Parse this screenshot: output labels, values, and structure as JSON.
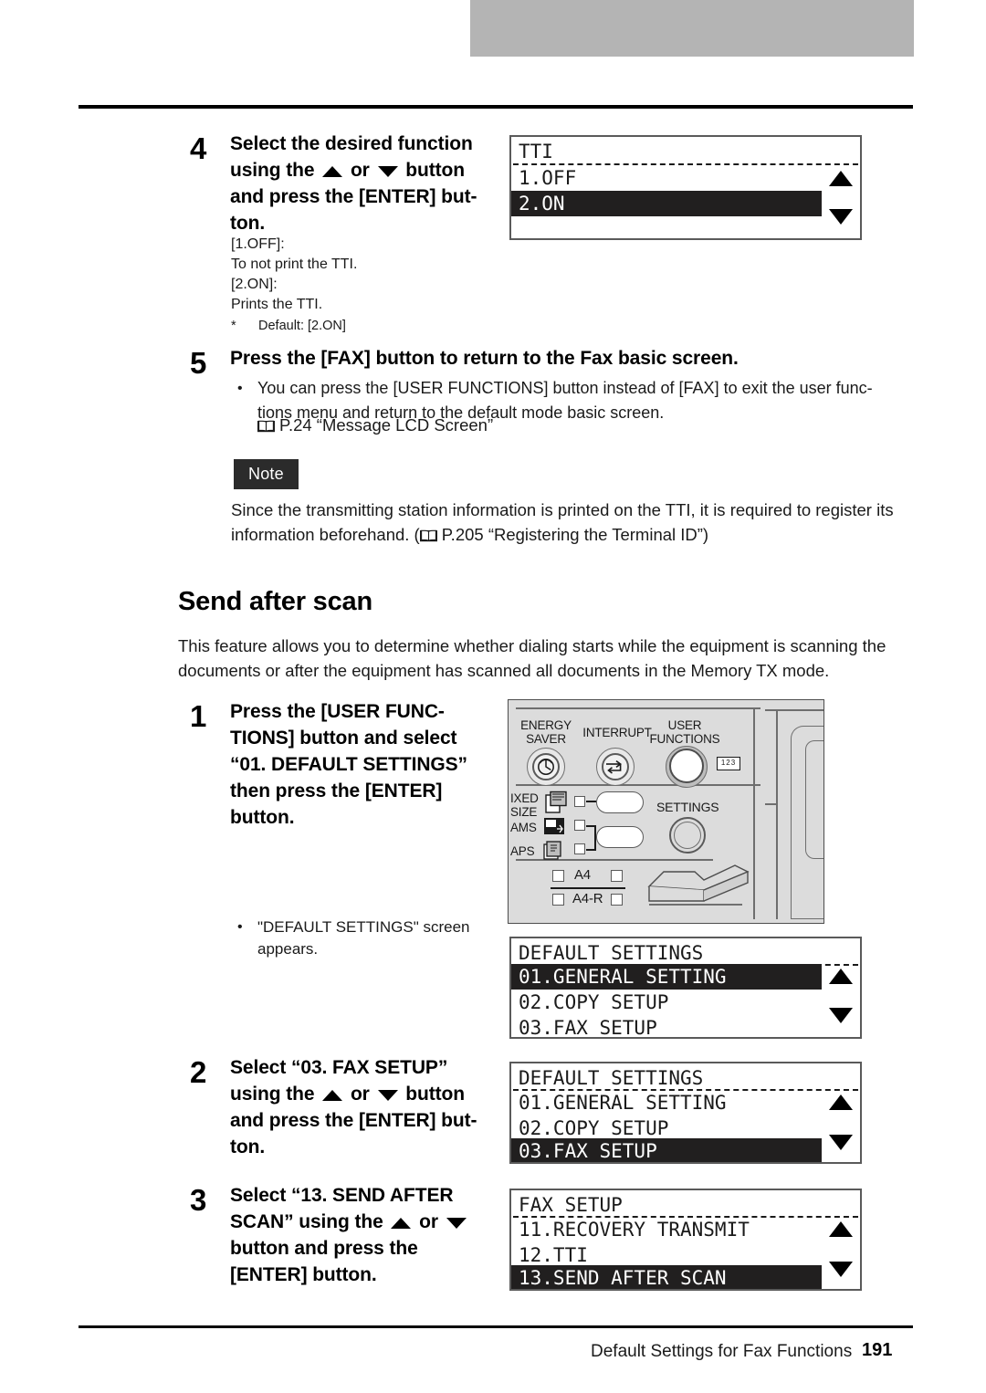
{
  "page": {
    "footer_section": "Default Settings for Fax Functions",
    "footer_page_number": "191"
  },
  "steps_tti": {
    "step4": {
      "number": "4",
      "title_part1": "Select the desired function",
      "title_part2a": "using the",
      "title_part2b": "or",
      "title_part2c": "button",
      "title_part3": "and press the [ENTER] but-",
      "title_part4": "ton.",
      "detail_line1": "[1.OFF]:",
      "detail_line2": "To not print the TTI.",
      "detail_line3": "[2.ON]:",
      "detail_line4": "Prints the TTI.",
      "detail_asterisk": "*",
      "detail_default": "Default: [2.ON]"
    },
    "step5": {
      "number": "5",
      "title": "Press the [FAX] button to return to the Fax basic screen.",
      "bullet_line1": "You can press the [USER FUNCTIONS] button instead of [FAX] to exit the user func-",
      "bullet_line2": "tions menu and return to the default mode basic screen.",
      "reference": "P.24 “Message LCD Screen”"
    }
  },
  "note": {
    "badge_label": "Note",
    "line1": "Since the transmitting station information is printed on the TTI, it is required to register its",
    "line2_pre": "information beforehand. (",
    "line2_ref": "P.205 “Registering the Terminal ID”)"
  },
  "section": {
    "heading": "Send after scan",
    "intro_line1": "This feature allows you to determine whether dialing starts while the equipment is scanning the",
    "intro_line2": "documents or after the equipment has scanned all documents in the Memory TX mode."
  },
  "steps_scan": {
    "step1": {
      "number": "1",
      "title_line1": "Press the [USER FUNC-",
      "title_line2": "TIONS] button and select",
      "title_line3": "“01. DEFAULT SETTINGS”",
      "title_line4": "then press the [ENTER]",
      "title_line5": "button.",
      "bullet_line1": "\"DEFAULT SETTINGS\" screen",
      "bullet_line2": "appears."
    },
    "step2": {
      "number": "2",
      "title_part1": "Select “03. FAX SETUP”",
      "title_part2a": "using the",
      "title_part2b": "or",
      "title_part2c": "button",
      "title_part3": "and press the [ENTER] but-",
      "title_part4": "ton."
    },
    "step3": {
      "number": "3",
      "title_part1": "Select “13. SEND AFTER",
      "title_part2a": "SCAN” using the",
      "title_part2b": "or",
      "title_part3": "button and press the",
      "title_part4": "[ENTER] button."
    }
  },
  "lcd_screens": {
    "tti": {
      "title": "TTI",
      "rows": [
        {
          "label": "1.OFF",
          "selected": false
        },
        {
          "label": "2.ON",
          "selected": true
        },
        {
          "label": "",
          "selected": false
        }
      ],
      "arrow_up": "scroll-up",
      "arrow_down": "scroll-down"
    },
    "default_settings_1": {
      "title": "DEFAULT SETTINGS",
      "rows": [
        {
          "label": "01.GENERAL SETTING",
          "selected": true
        },
        {
          "label": "02.COPY SETUP",
          "selected": false
        },
        {
          "label": "03.FAX SETUP",
          "selected": false
        }
      ],
      "arrow_up": "scroll-up",
      "arrow_down": "scroll-down"
    },
    "default_settings_2": {
      "title": "DEFAULT SETTINGS",
      "rows": [
        {
          "label": "01.GENERAL SETTING",
          "selected": false
        },
        {
          "label": "02.COPY SETUP",
          "selected": false
        },
        {
          "label": "03.FAX SETUP",
          "selected": true
        }
      ],
      "arrow_up": "scroll-up",
      "arrow_down": "scroll-down"
    },
    "fax_setup": {
      "title": "FAX SETUP",
      "rows": [
        {
          "label": "11.RECOVERY TRANSMIT",
          "selected": false
        },
        {
          "label": "12.TTI",
          "selected": false
        },
        {
          "label": "13.SEND AFTER SCAN",
          "selected": true
        }
      ],
      "arrow_up": "scroll-up",
      "arrow_down": "scroll-down"
    }
  },
  "control_panel": {
    "energy_saver_line1": "ENERGY",
    "energy_saver_line2": "SAVER",
    "interrupt": "INTERRUPT",
    "user_functions_line1": "USER",
    "user_functions_line2": "FUNCTIONS",
    "keypad_badge": "123",
    "mixed_size_line1": "IXED",
    "mixed_size_line2": "SIZE",
    "ams": "AMS",
    "aps": "APS",
    "settings": "SETTINGS",
    "paper_size": "A4",
    "paper_size2": "A4-R"
  },
  "colors": {
    "header_gray": "#b4b4b4",
    "lcd_highlight": "#211f1f",
    "note_badge_bg": "#2b2b2b",
    "panel_gray": "#dcdcdc",
    "rule_black": "#000000"
  }
}
